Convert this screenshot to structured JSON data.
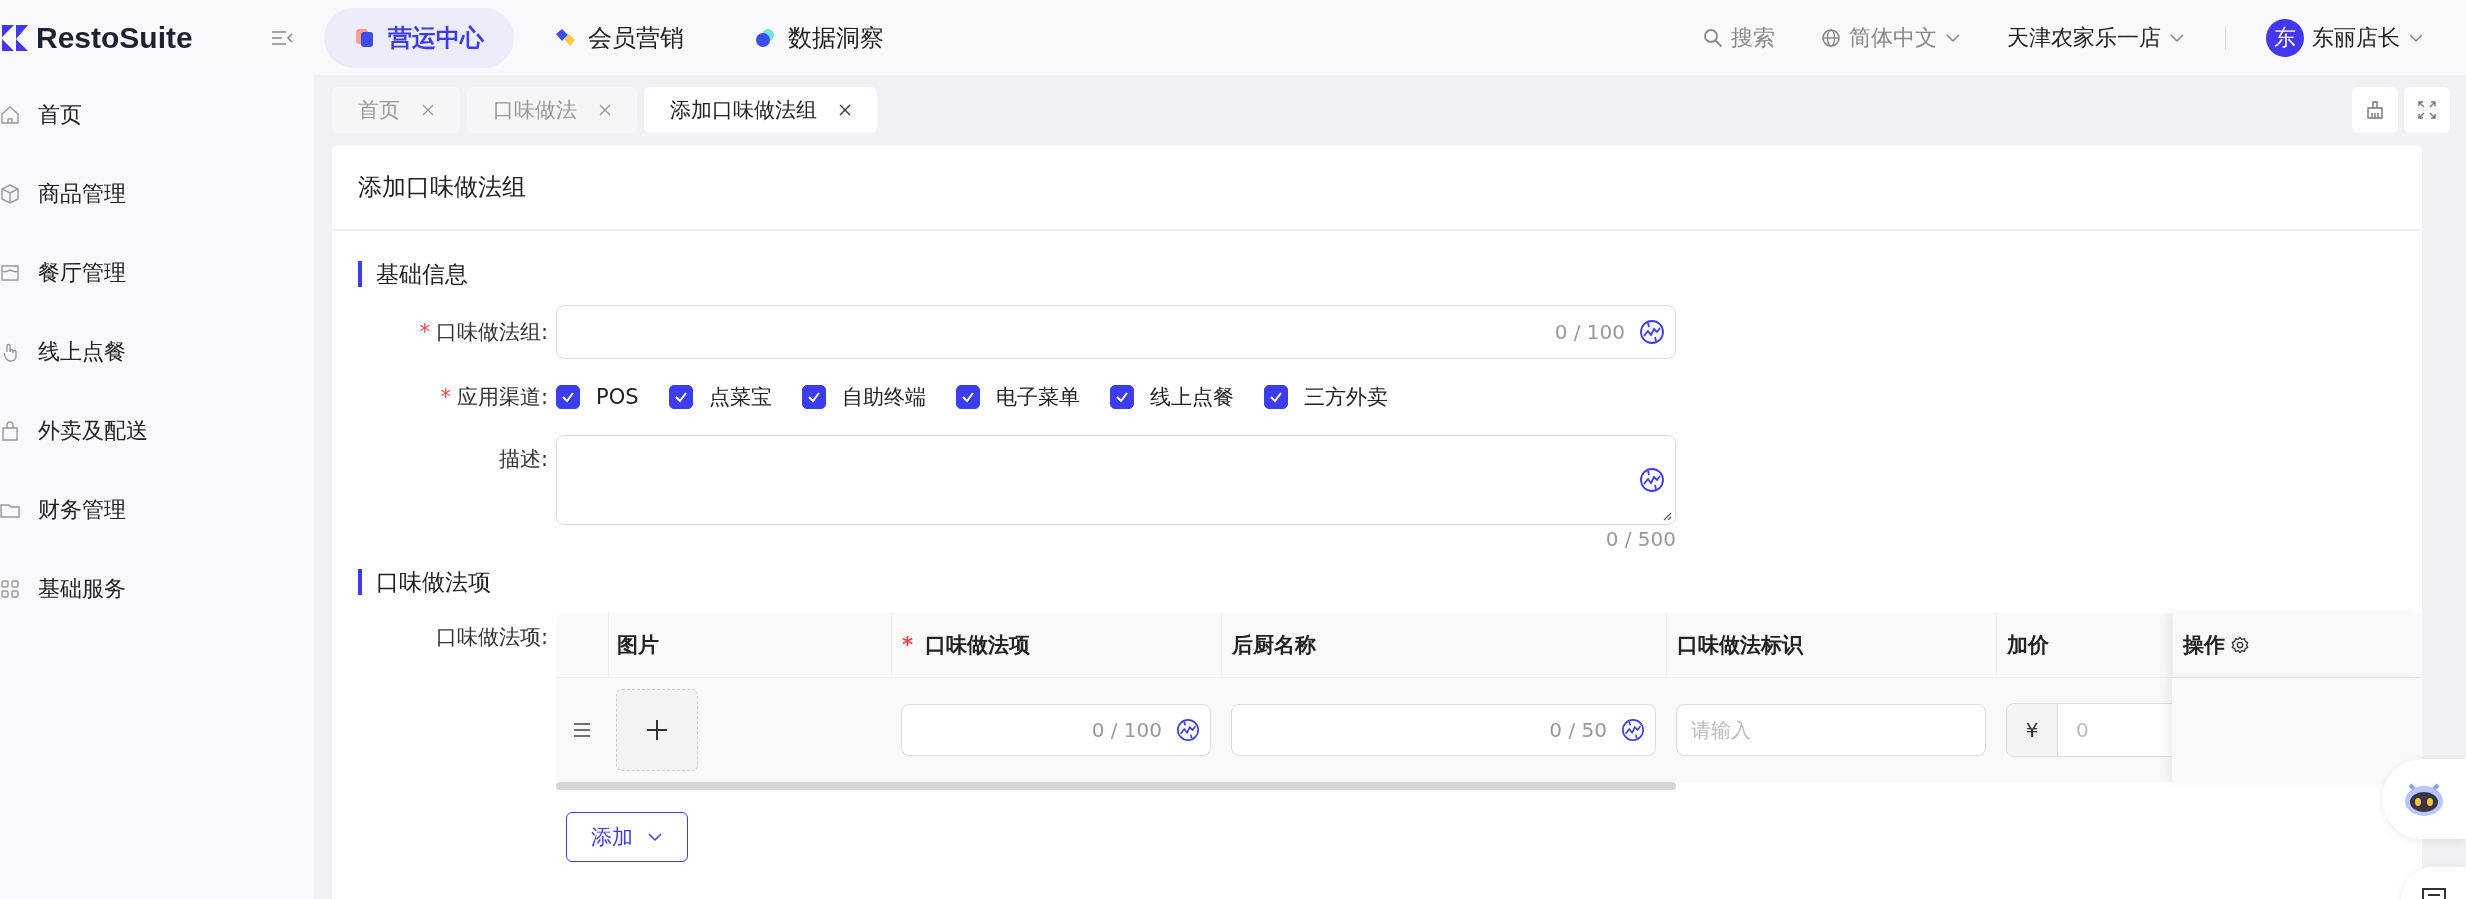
{
  "brand": {
    "name": "RestoSuite"
  },
  "top_nav": [
    {
      "label": "营运中心",
      "selected": true
    },
    {
      "label": "会员营销",
      "selected": false
    },
    {
      "label": "数据洞察",
      "selected": false
    }
  ],
  "header": {
    "search": "搜索",
    "language": "简体中文",
    "store": "天津农家乐一店",
    "avatar": "东",
    "user": "东丽店长"
  },
  "sidebar": {
    "items": [
      {
        "label": "首页"
      },
      {
        "label": "商品管理"
      },
      {
        "label": "餐厅管理"
      },
      {
        "label": "线上点餐"
      },
      {
        "label": "外卖及配送"
      },
      {
        "label": "财务管理"
      },
      {
        "label": "基础服务"
      }
    ]
  },
  "page_tabs": [
    {
      "label": "首页",
      "selected": false
    },
    {
      "label": "口味做法",
      "selected": false
    },
    {
      "label": "添加口味做法组",
      "selected": true
    }
  ],
  "card": {
    "title": "添加口味做法组",
    "section_basic": "基础信息",
    "group_field": {
      "label": "口味做法组:",
      "required_mark": "*",
      "counter": "0 / 100"
    },
    "channels": {
      "label": "应用渠道:",
      "required_mark": "*",
      "options": [
        {
          "label": "POS",
          "checked": true
        },
        {
          "label": "点菜宝",
          "checked": true
        },
        {
          "label": "自助终端",
          "checked": true
        },
        {
          "label": "电子菜单",
          "checked": true
        },
        {
          "label": "线上点餐",
          "checked": true
        },
        {
          "label": "三方外卖",
          "checked": true
        }
      ]
    },
    "description": {
      "label": "描述:",
      "counter": "0 / 500"
    },
    "section_items": "口味做法项",
    "items_label": "口味做法项:",
    "table": {
      "columns": [
        {
          "label": "图片"
        },
        {
          "label": "口味做法项",
          "required_mark": "*"
        },
        {
          "label": "后厨名称"
        },
        {
          "label": "口味做法标识"
        },
        {
          "label": "加价"
        },
        {
          "label": "操作"
        }
      ],
      "rows": [
        {
          "item_counter": "0 / 100",
          "kitchen_counter": "0 / 50",
          "code_placeholder": "请输入",
          "currency": "¥",
          "price_placeholder": "0"
        }
      ]
    },
    "add_button": "添加"
  }
}
